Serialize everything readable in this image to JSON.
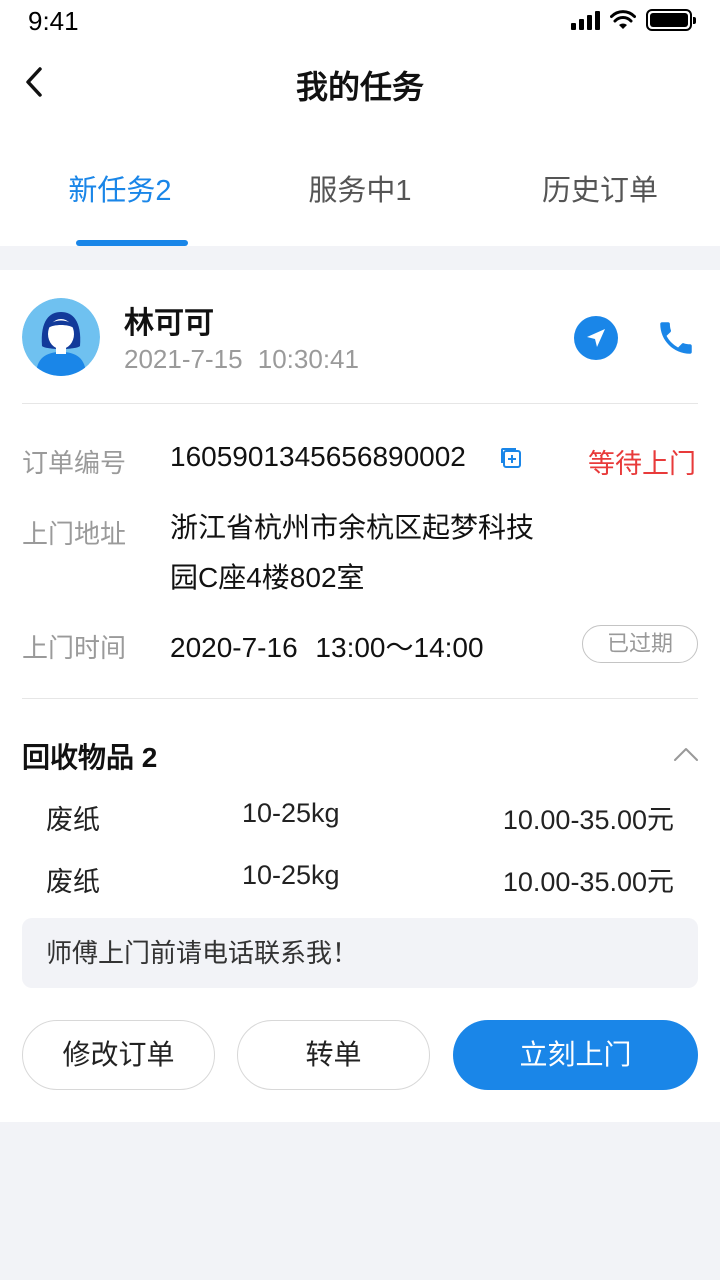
{
  "status_bar": {
    "time": "9:41",
    "battery_level": 1.0
  },
  "nav": {
    "title": "我的任务",
    "back_icon": "chevron-left-icon"
  },
  "tabs": [
    {
      "label": "新任务2",
      "active": true
    },
    {
      "label": "服务中1",
      "active": false
    },
    {
      "label": "历史订单",
      "active": false
    }
  ],
  "order": {
    "customer_name": "林可可",
    "customer_time": "2021-7-15 10:30:41",
    "order_no_label": "订单编号",
    "order_no": "1605901345656890002",
    "status": "等待上门",
    "address_label": "上门地址",
    "address_line1": "浙江省杭州市余杭区起梦科技",
    "address_line2": "园C座4楼802室",
    "time_label": "上门时间",
    "service_time": "2020-7-16 13:00～14:00",
    "expired_badge": "已过期"
  },
  "recycle": {
    "title": "回收物品 2",
    "items": [
      {
        "name": "废纸",
        "weight": "10-25kg",
        "price": "10.00-35.00元"
      },
      {
        "name": "废纸",
        "weight": "10-25kg",
        "price": "10.00-35.00元"
      }
    ]
  },
  "note": "师傅上门前请电话联系我！",
  "actions": {
    "modify": "修改订单",
    "transfer": "转单",
    "visit": "立刻上门"
  },
  "colors": {
    "accent": "#1a86e8",
    "status_red": "#e83a3a",
    "background": "#f2f3f7"
  }
}
